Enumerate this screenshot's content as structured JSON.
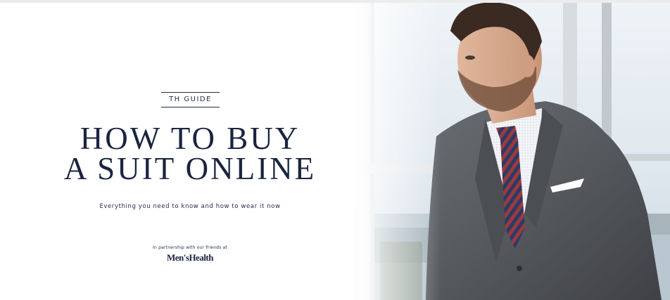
{
  "hero": {
    "kicker": "TH GUIDE",
    "headline_line1": "HOW TO BUY",
    "headline_line2": "A SUIT ONLINE",
    "subhead": "Everything you need to know and how to wear it now",
    "partner_note": "In partnership with our friends at",
    "partner_logo": "Men'sHealth"
  },
  "colors": {
    "navy_text": "#1a2440",
    "background": "#ffffff",
    "suit_grey": "#55585d"
  }
}
